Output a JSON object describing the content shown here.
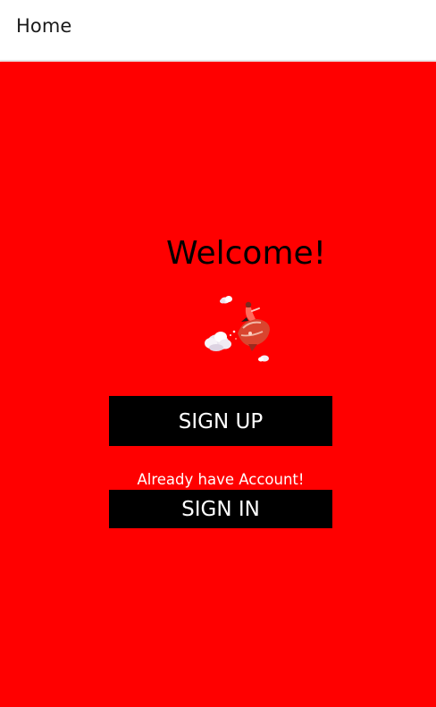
{
  "header": {
    "title": "Home"
  },
  "welcome": {
    "title": "Welcome!",
    "illustration_icon": "rocket-rider-illustration"
  },
  "buttons": {
    "signup_label": "SIGN UP",
    "signin_label": "SIGN IN"
  },
  "account_prompt": "Already have Account!",
  "colors": {
    "background": "#ff0000",
    "header_background": "#ffffff",
    "button_background": "#000000",
    "button_text": "#ffffff",
    "title_text": "#000000"
  }
}
